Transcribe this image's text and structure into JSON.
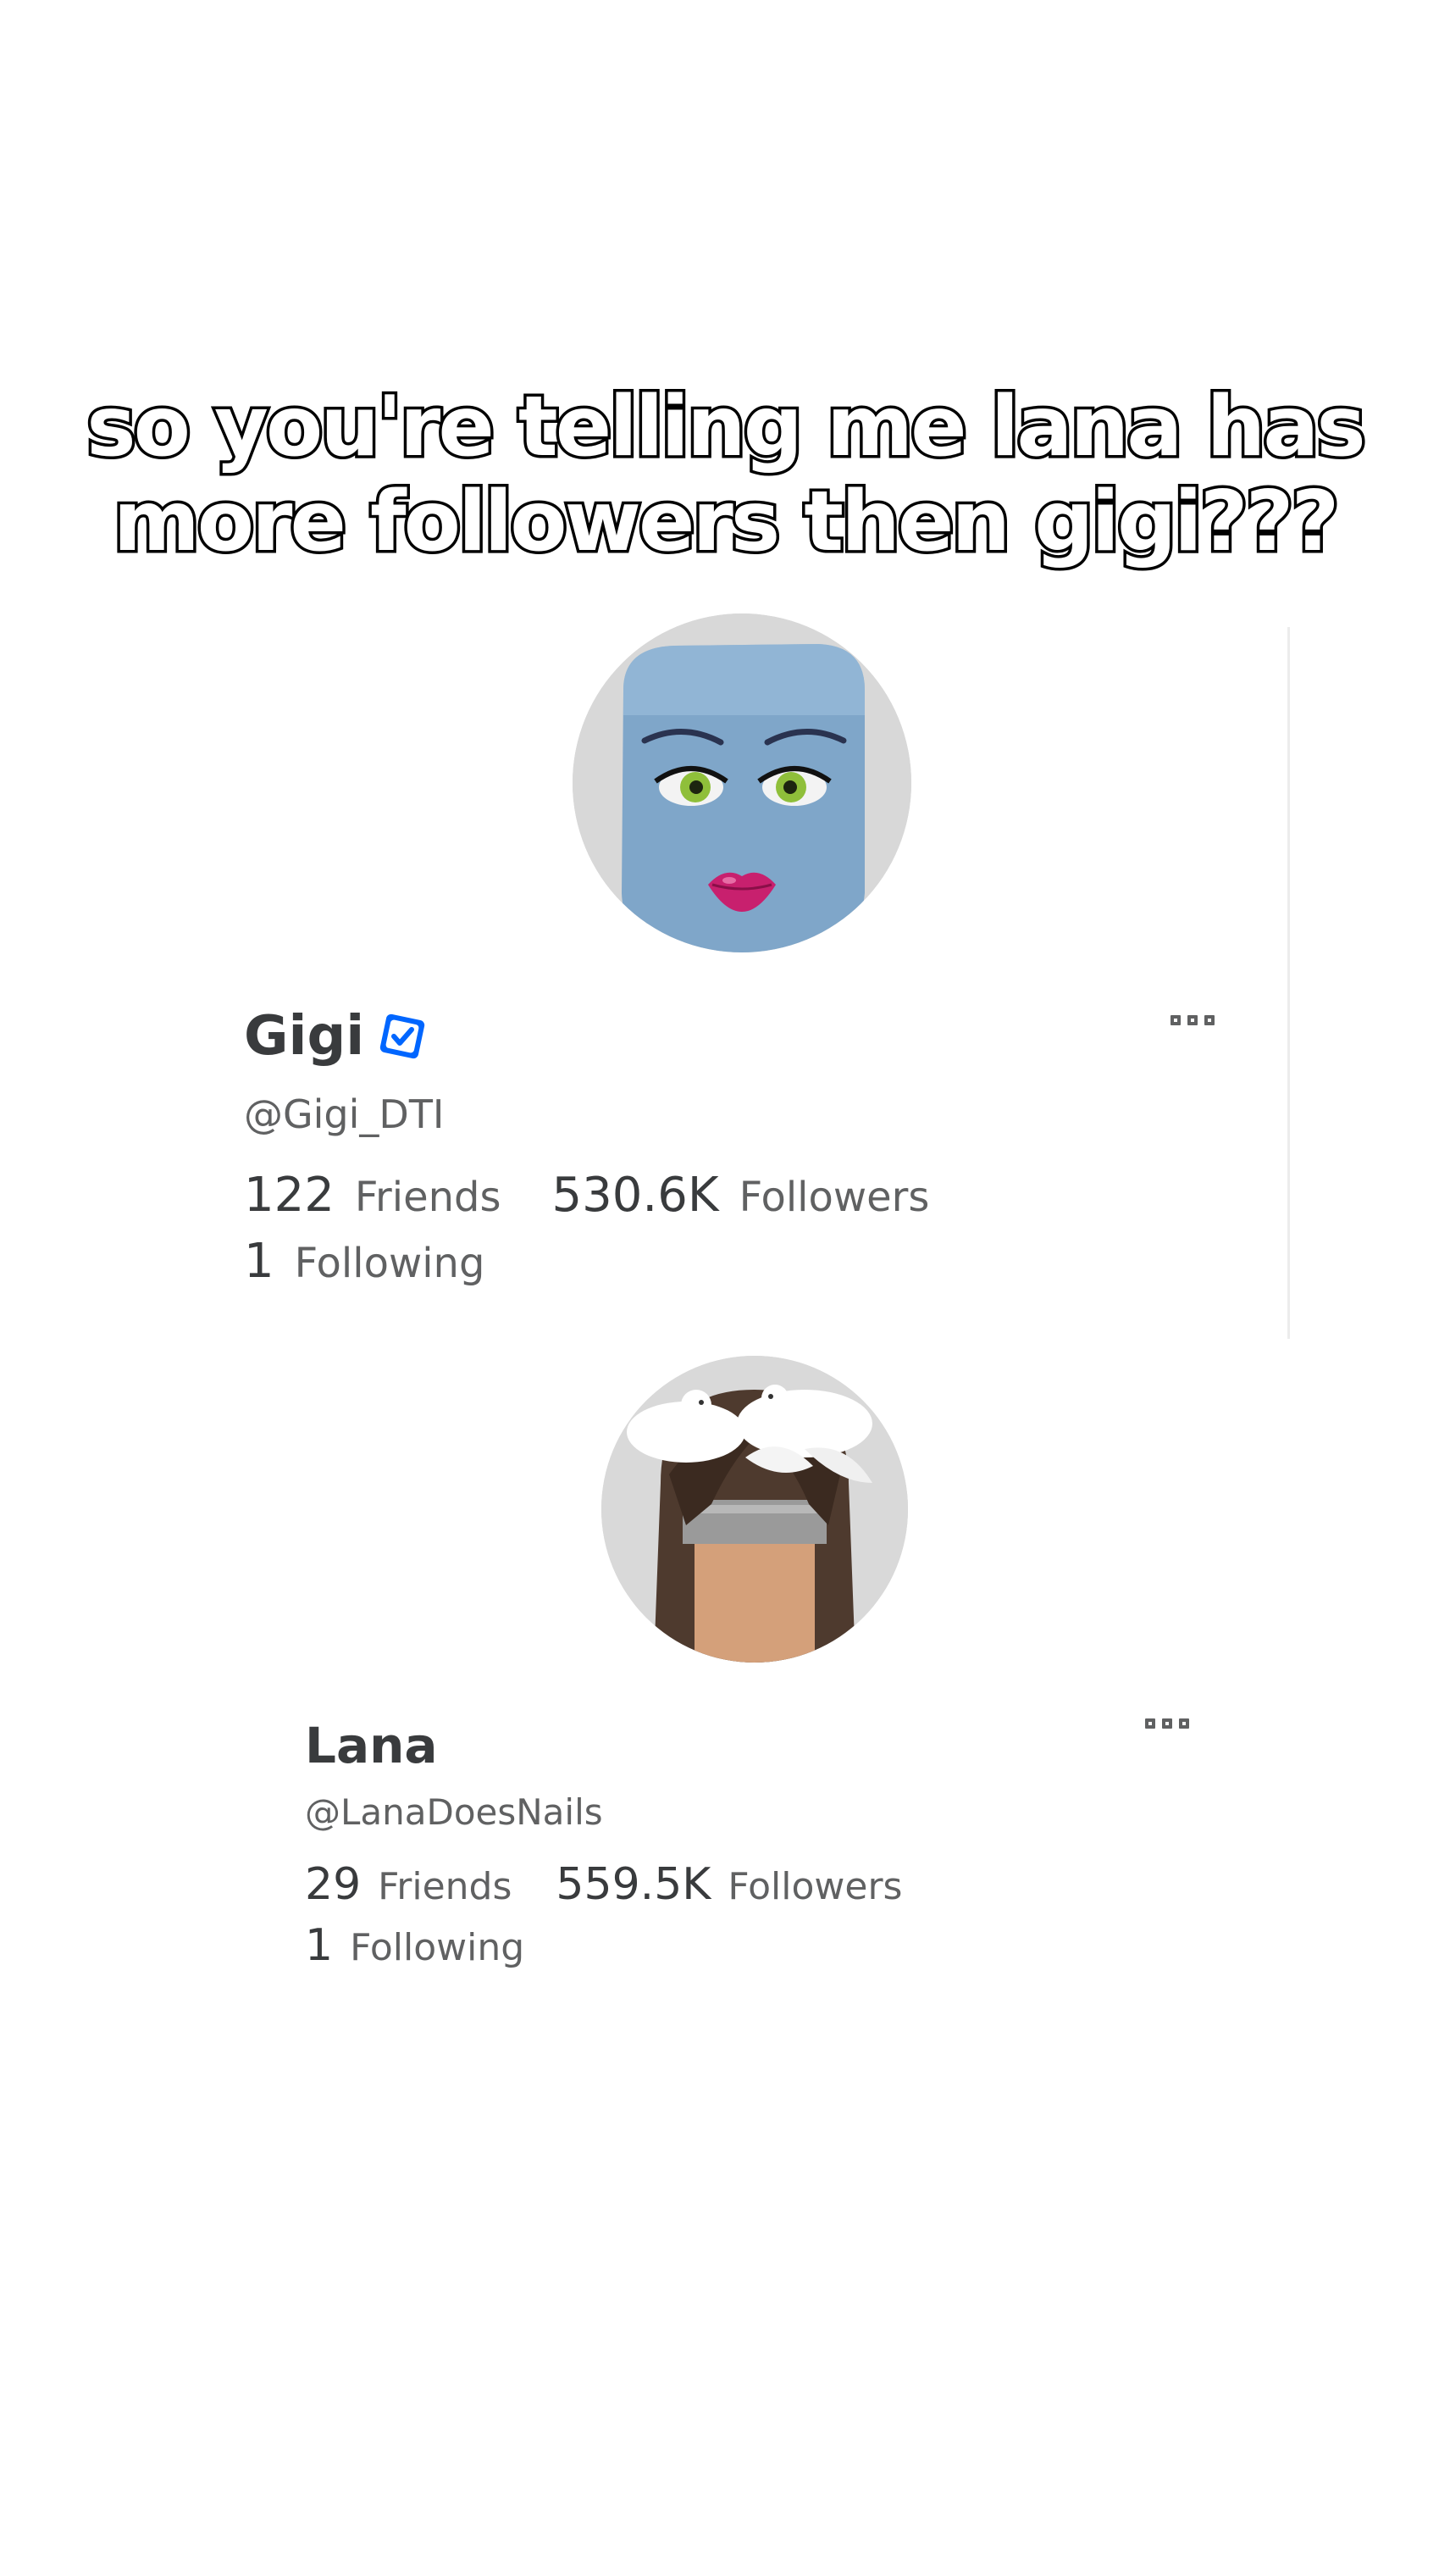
{
  "caption": {
    "line1": "so you're telling me lana has",
    "line2": "more followers then gigi???"
  },
  "profiles": [
    {
      "display_name": "Gigi",
      "verified": true,
      "handle": "@Gigi_DTI",
      "friends_count": "122",
      "friends_label": "Friends",
      "followers_count": "530.6K",
      "followers_label": "Followers",
      "following_count": "1",
      "following_label": "Following"
    },
    {
      "display_name": "Lana",
      "verified": false,
      "handle": "@LanaDoesNails",
      "friends_count": "29",
      "friends_label": "Friends",
      "followers_count": "559.5K",
      "followers_label": "Followers",
      "following_count": "1",
      "following_label": "Following"
    }
  ],
  "colors": {
    "verified_blue": "#0066ff",
    "name_text": "#393b3d",
    "secondary_text": "#606162"
  },
  "icons": {
    "more": "more-options-icon",
    "verified": "verified-badge-icon"
  }
}
